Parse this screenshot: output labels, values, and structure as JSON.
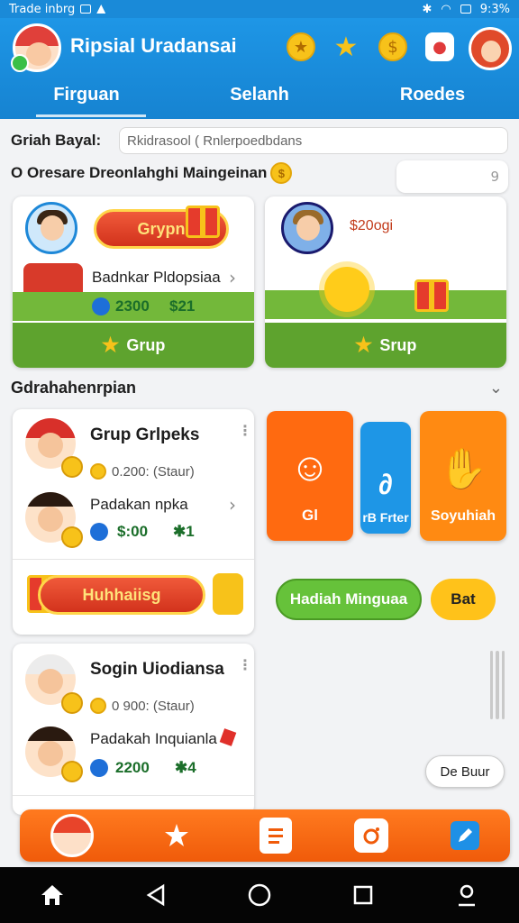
{
  "status_bar": {
    "left_text": "Trade inbrg",
    "right_text": "9:3%"
  },
  "header": {
    "title": "Ripsial Uradansai"
  },
  "tabs": [
    {
      "label": "Firguan"
    },
    {
      "label": "Selanh"
    },
    {
      "label": "Roedes"
    }
  ],
  "search": {
    "label": "Griah Bayal:",
    "value": "Rkidrasool ( Rnlerpoedbdans"
  },
  "section1": {
    "title": "O Oresare Dreonlahghi Maingeinan",
    "pill_value": "9"
  },
  "promo_cards": [
    {
      "ribbon": "Grypn",
      "item_label": "Badnkar Pldopsiaa",
      "stat_a": "2300",
      "stat_b": "$21",
      "button": "Grup"
    },
    {
      "price": "$20ogi",
      "button": "Srup"
    }
  ],
  "section2": {
    "title": "Gdrahahenrpian"
  },
  "list_cards": [
    {
      "title": "Grup Grlpeks",
      "sub": "0.200: (Staur)",
      "item_label": "Padakan npka",
      "stat_a": "$:00",
      "stat_b": "1",
      "ribbon": "Huhhaiisg"
    },
    {
      "title": "Sogin Uiodiansa",
      "sub": "0 900: (Staur)",
      "item_label": "Padakah Inquianla",
      "stat_a": "2200",
      "stat_b": "4"
    }
  ],
  "tiles": [
    {
      "label": "Gl",
      "color": "#ff6a10"
    },
    {
      "label": "rB Frter",
      "color": "#1e96e6"
    },
    {
      "label": "Soyuhiah",
      "color": "#ff8a12"
    }
  ],
  "buttons": {
    "hadiah": "Hadiah Minguaa",
    "bat": "Bat",
    "float": "De Buur"
  }
}
